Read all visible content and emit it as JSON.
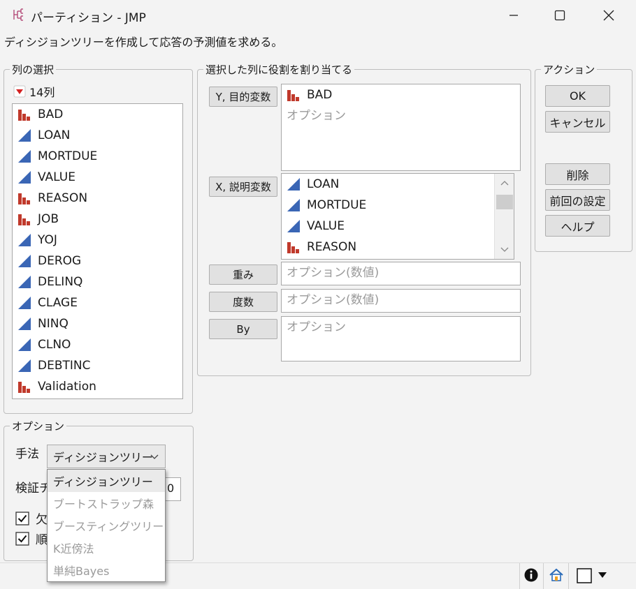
{
  "window": {
    "title": "パーティション - JMP",
    "description": "ディシジョンツリーを作成して応答の予測値を求める。"
  },
  "columns": {
    "legend": "列の選択",
    "count": "14列",
    "items": [
      {
        "name": "BAD",
        "type": "nominal"
      },
      {
        "name": "LOAN",
        "type": "continuous"
      },
      {
        "name": "MORTDUE",
        "type": "continuous"
      },
      {
        "name": "VALUE",
        "type": "continuous"
      },
      {
        "name": "REASON",
        "type": "nominal"
      },
      {
        "name": "JOB",
        "type": "nominal"
      },
      {
        "name": "YOJ",
        "type": "continuous"
      },
      {
        "name": "DEROG",
        "type": "continuous"
      },
      {
        "name": "DELINQ",
        "type": "continuous"
      },
      {
        "name": "CLAGE",
        "type": "continuous"
      },
      {
        "name": "NINQ",
        "type": "continuous"
      },
      {
        "name": "CLNO",
        "type": "continuous"
      },
      {
        "name": "DEBTINC",
        "type": "continuous"
      },
      {
        "name": "Validation",
        "type": "nominal"
      }
    ]
  },
  "roles": {
    "legend": "選択した列に役割を割り当てる",
    "y": {
      "label": "Y, 目的変数",
      "value": "BAD",
      "placeholder": "オプション"
    },
    "x": {
      "label": "X, 説明変数",
      "items": [
        "LOAN",
        "MORTDUE",
        "VALUE",
        "REASON"
      ]
    },
    "weight": {
      "label": "重み",
      "placeholder": "オプション(数値)"
    },
    "freq": {
      "label": "度数",
      "placeholder": "オプション(数値)"
    },
    "by": {
      "label": "By",
      "placeholder": "オプション"
    }
  },
  "actions": {
    "legend": "アクション",
    "ok": "OK",
    "cancel": "キャンセル",
    "remove": "削除",
    "recall": "前回の設定",
    "help": "ヘルプ"
  },
  "options": {
    "legend": "オプション",
    "method_label": "手法",
    "method_value": "ディシジョンツリー",
    "validation_label_partial": "検証チ",
    "validation_value_partial": "0",
    "checkbox1_partial": "欠",
    "checkbox2_partial": "順",
    "method_options": [
      "ディシジョンツリー",
      "ブートストラップ森",
      "ブースティングツリー",
      "K近傍法",
      "単純Bayes"
    ]
  },
  "colors": {
    "nominal": "#c0392b",
    "continuous": "#3a66b5",
    "red_triangle": "#d42222"
  },
  "icons": {
    "app": "jmp-partition-icon",
    "status": [
      "info-icon",
      "home-icon",
      "window-icon",
      "dropdown-arrow-icon"
    ]
  }
}
